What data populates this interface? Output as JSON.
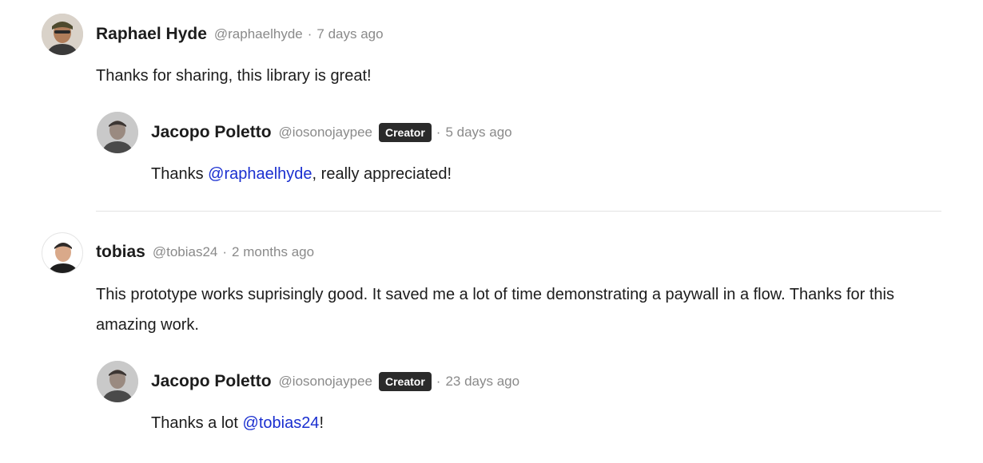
{
  "comments": [
    {
      "name": "Raphael Hyde",
      "handle": "@raphaelhyde",
      "sep": "·",
      "time": "7 days ago",
      "text": "Thanks for sharing, this library is great!",
      "reply": {
        "name": "Jacopo Poletto",
        "handle": "@iosonojaypee",
        "badge": "Creator",
        "sep": "·",
        "time": "5 days ago",
        "text_before": "Thanks ",
        "mention": "@raphaelhyde",
        "text_after": ", really appreciated!"
      }
    },
    {
      "name": "tobias",
      "handle": "@tobias24",
      "sep": "·",
      "time": "2 months ago",
      "text": "This prototype works suprisingly good. It saved me a lot of time demonstrating a paywall in a flow. Thanks for this amazing work.",
      "reply": {
        "name": "Jacopo Poletto",
        "handle": "@iosonojaypee",
        "badge": "Creator",
        "sep": "·",
        "time": "23 days ago",
        "text_before": "Thanks a lot ",
        "mention": "@tobias24",
        "text_after": "!"
      }
    }
  ],
  "colors": {
    "mention": "#1a2fd0",
    "badge_bg": "#2b2b2b",
    "muted": "#8a8a8a",
    "divider": "#e2e2e2"
  }
}
